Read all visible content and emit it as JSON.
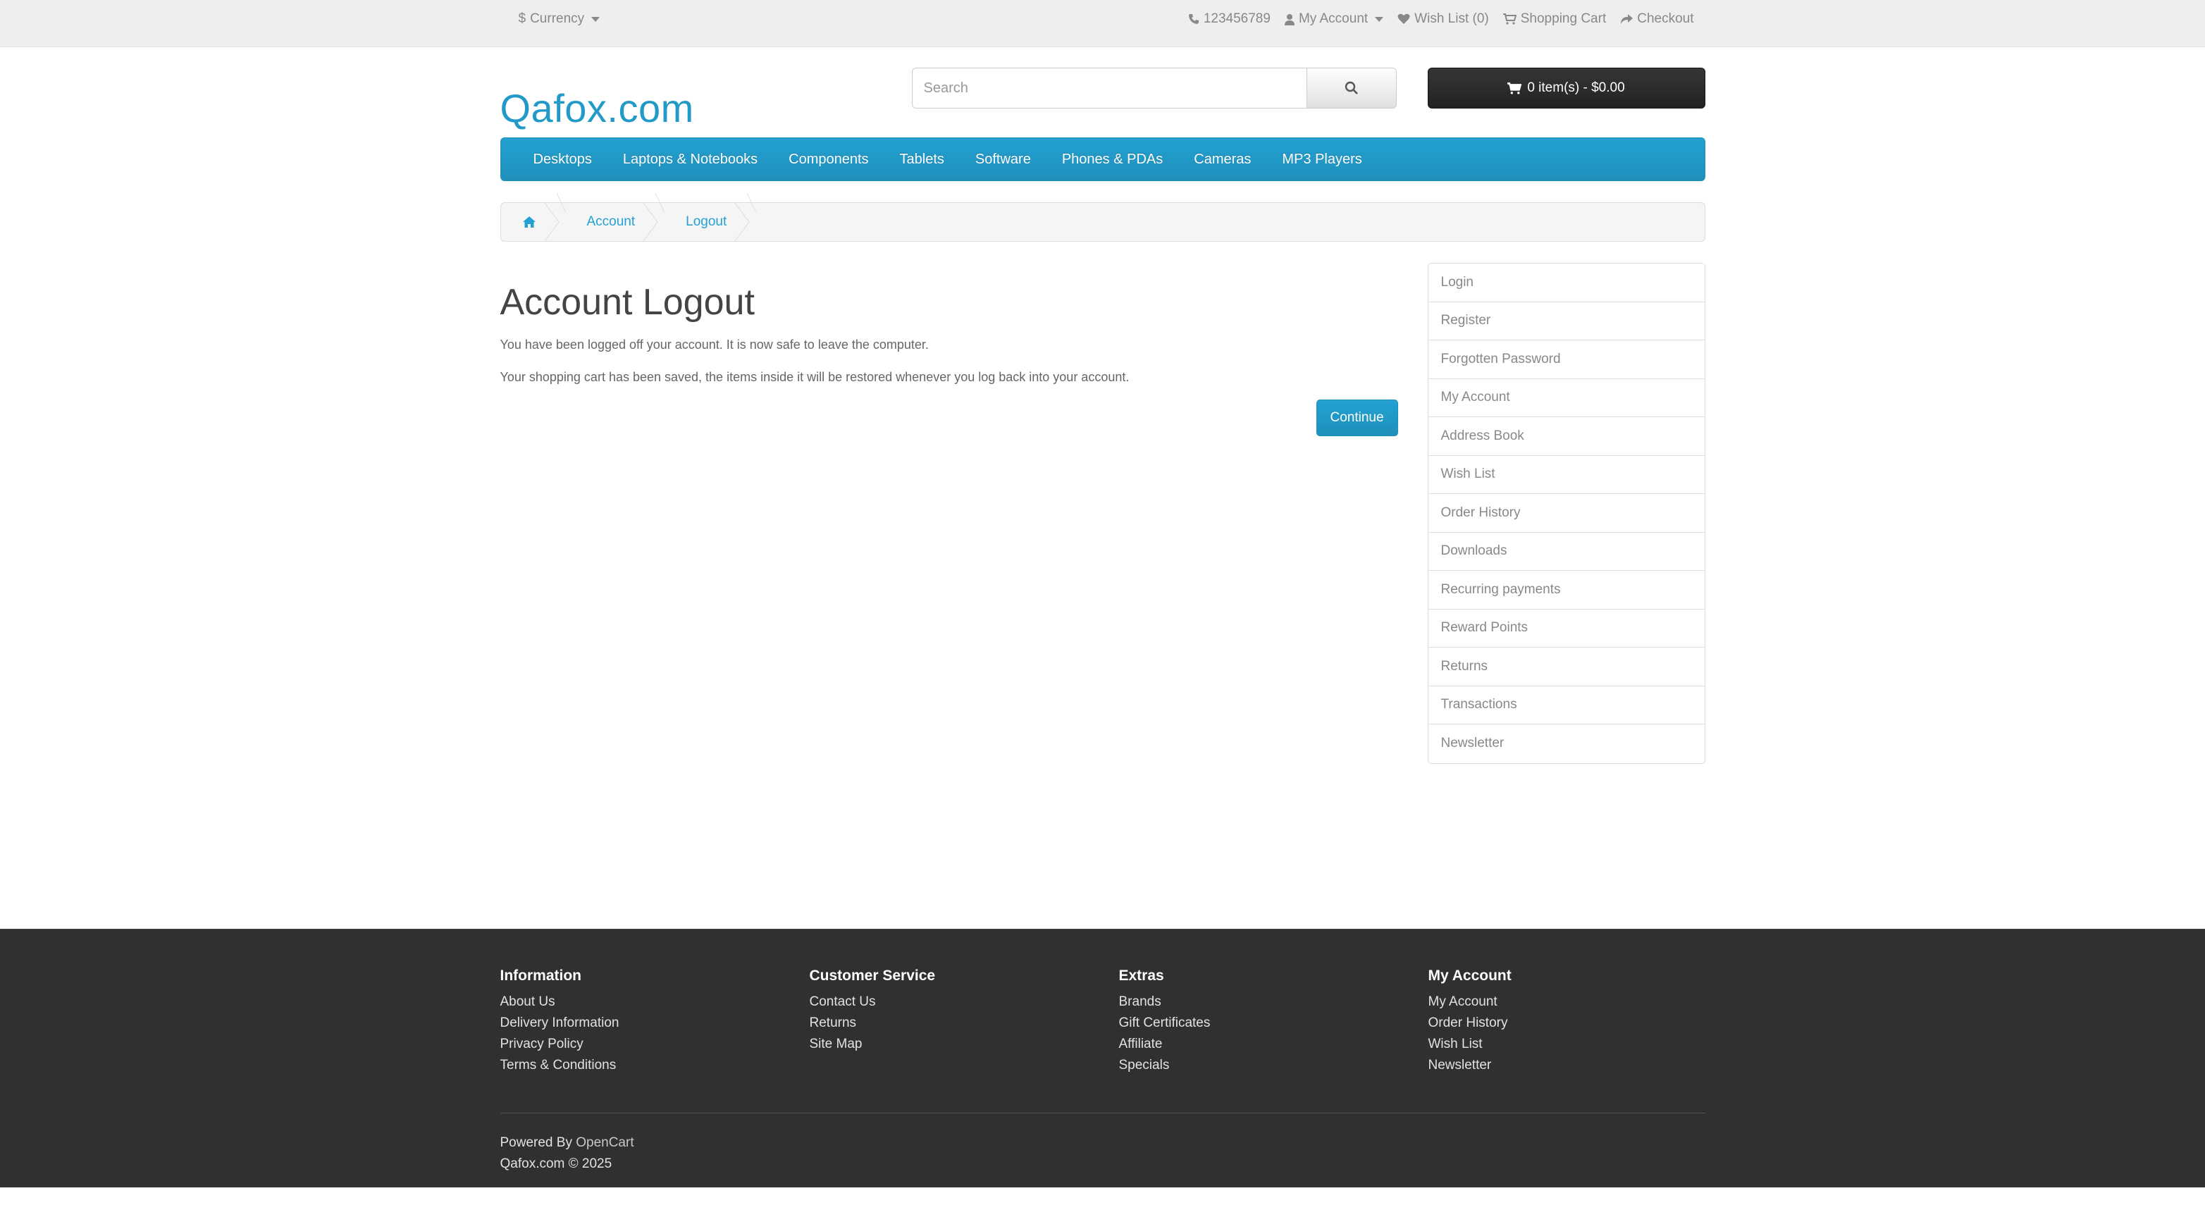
{
  "top_bar": {
    "currency_symbol": "$",
    "currency_label": "Currency",
    "phone": "123456789",
    "my_account": "My Account",
    "wishlist": "Wish List (0)",
    "shopping_cart": "Shopping Cart",
    "checkout": "Checkout"
  },
  "header": {
    "logo": "Qafox.com",
    "search_placeholder": "Search",
    "cart_label": "0 item(s) - $0.00"
  },
  "menu": {
    "items": [
      "Desktops",
      "Laptops & Notebooks",
      "Components",
      "Tablets",
      "Software",
      "Phones & PDAs",
      "Cameras",
      "MP3 Players"
    ]
  },
  "breadcrumb": {
    "items": [
      "Account",
      "Logout"
    ]
  },
  "main": {
    "title": "Account Logout",
    "paragraph_1": "You have been logged off your account. It is now safe to leave the computer.",
    "paragraph_2": "Your shopping cart has been saved, the items inside it will be restored whenever you log back into your account.",
    "continue_label": "Continue"
  },
  "sidebar": {
    "items": [
      "Login",
      "Register",
      "Forgotten Password",
      "My Account",
      "Address Book",
      "Wish List",
      "Order History",
      "Downloads",
      "Recurring payments",
      "Reward Points",
      "Returns",
      "Transactions",
      "Newsletter"
    ]
  },
  "footer": {
    "columns": [
      {
        "heading": "Information",
        "links": [
          "About Us",
          "Delivery Information",
          "Privacy Policy",
          "Terms & Conditions"
        ]
      },
      {
        "heading": "Customer Service",
        "links": [
          "Contact Us",
          "Returns",
          "Site Map"
        ]
      },
      {
        "heading": "Extras",
        "links": [
          "Brands",
          "Gift Certificates",
          "Affiliate",
          "Specials"
        ]
      },
      {
        "heading": "My Account",
        "links": [
          "My Account",
          "Order History",
          "Wish List",
          "Newsletter"
        ]
      }
    ],
    "powered_by": "Powered By",
    "powered_link": "OpenCart",
    "copyright": "Qafox.com © 2025"
  },
  "colors": {
    "accent": "#229ac8",
    "footer_bg": "#303030",
    "cart_bg": "#2b2b2b"
  }
}
